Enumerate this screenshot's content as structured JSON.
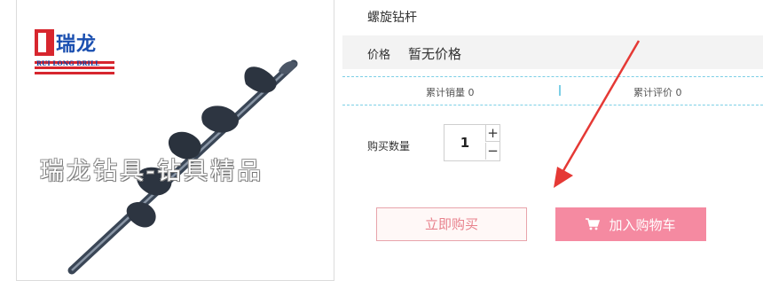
{
  "product": {
    "title": "螺旋钻杆",
    "price_label": "价格",
    "price_value": "暂无价格",
    "sales_label": "累计销量 0",
    "reviews_label": "累计评价 0"
  },
  "image": {
    "logo_cn": "瑞龙",
    "logo_en": "RUI LONG DRILL",
    "watermark": "瑞龙钻具-钻具精品"
  },
  "quantity": {
    "label": "购买数量",
    "value": "1",
    "plus": "+",
    "minus": "−"
  },
  "actions": {
    "buy_now": "立即购买",
    "add_to_cart": "加入购物车"
  },
  "icons": {
    "cart": "cart-icon",
    "arrow": "red-arrow-annotation"
  },
  "colors": {
    "accent_pink": "#f58aa1",
    "buy_border": "#e8a4ab",
    "divider_blue": "#7ccfe6",
    "arrow_red": "#e53935",
    "logo_red": "#d7262e",
    "logo_blue": "#1a4fb0"
  }
}
